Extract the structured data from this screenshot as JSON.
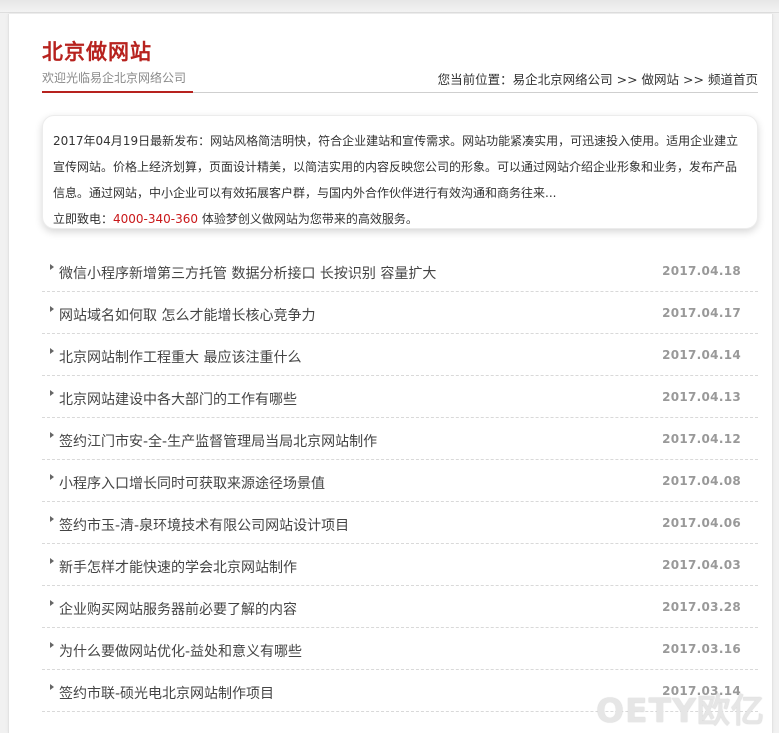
{
  "header": {
    "title": "北京做网站",
    "subtitle": "欢迎光临易企北京网络公司",
    "breadcrumb": {
      "prefix": "您当前位置：",
      "crumb1": "易企北京网络公司",
      "sep1": ">>",
      "crumb2": "做网站",
      "sep2": ">>",
      "crumb3": "频道首页"
    }
  },
  "intro": {
    "text": "2017年04月19日最新发布：网站风格简洁明快，符合企业建站和宣传需求。网站功能紧凑实用，可迅速投入使用。适用企业建立宣传网站。价格上经济划算，页面设计精美，以简洁实用的内容反映您公司的形象。可以通过网站介绍企业形象和业务，发布产品信息。通过网站，中小企业可以有效拓展客户群，与国内外合作伙伴进行有效沟通和商务往来...",
    "call_prefix": "立即致电：",
    "phone": "4000-340-360",
    "call_suffix": "体验梦创义做网站为您带来的高效服务。"
  },
  "articles": [
    {
      "title": "微信小程序新增第三方托管 数据分析接口 长按识别 容量扩大",
      "date": "2017.04.18"
    },
    {
      "title": "网站域名如何取 怎么才能增长核心竞争力",
      "date": "2017.04.17"
    },
    {
      "title": "北京网站制作工程重大 最应该注重什么",
      "date": "2017.04.14"
    },
    {
      "title": "北京网站建设中各大部门的工作有哪些",
      "date": "2017.04.13"
    },
    {
      "title": "签约江门市安-全-生产监督管理局当局北京网站制作",
      "date": "2017.04.12"
    },
    {
      "title": "小程序入口增长同时可获取来源途径场景值",
      "date": "2017.04.08"
    },
    {
      "title": "签约市玉-清-泉环境技术有限公司网站设计项目",
      "date": "2017.04.06"
    },
    {
      "title": "新手怎样才能快速的学会北京网站制作",
      "date": "2017.04.03"
    },
    {
      "title": "企业购买网站服务器前必要了解的内容",
      "date": "2017.03.28"
    },
    {
      "title": "为什么要做网站优化-益处和意义有哪些",
      "date": "2017.03.16"
    },
    {
      "title": "签约市联-硕光电北京网站制作项目",
      "date": "2017.03.14"
    }
  ],
  "watermark": "OETY欧亿",
  "colors": {
    "accent": "#b7221e",
    "phone": "#c9181a",
    "date": "#999999"
  }
}
